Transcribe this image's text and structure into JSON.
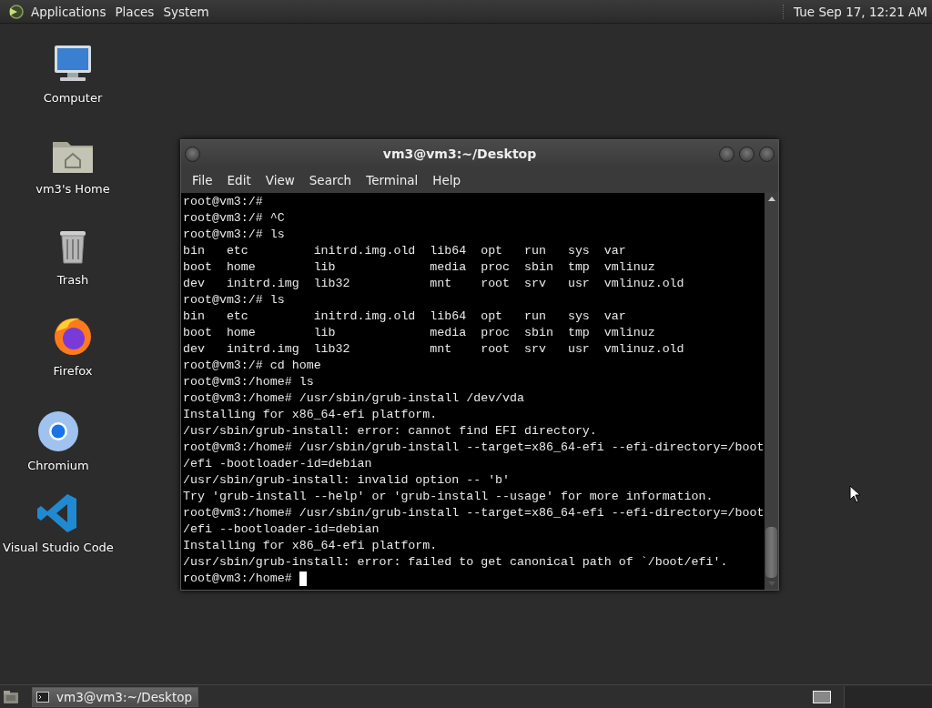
{
  "top_panel": {
    "menus": [
      "Applications",
      "Places",
      "System"
    ],
    "clock": "Tue Sep 17, 12:21 AM"
  },
  "desktop_icons": [
    {
      "kind": "computer",
      "label": "Computer"
    },
    {
      "kind": "home",
      "label": "vm3's Home"
    },
    {
      "kind": "trash",
      "label": "Trash"
    },
    {
      "kind": "firefox",
      "label": "Firefox"
    },
    {
      "kind": "chromium",
      "label": "Chromium"
    },
    {
      "kind": "vscode",
      "label": "Visual Studio Code"
    }
  ],
  "terminal_window": {
    "title": "vm3@vm3:~/Desktop",
    "menu": [
      "File",
      "Edit",
      "View",
      "Search",
      "Terminal",
      "Help"
    ],
    "lines": [
      "root@vm3:/#",
      "root@vm3:/# ^C",
      "root@vm3:/# ls",
      "bin   etc         initrd.img.old  lib64  opt   run   sys  var",
      "boot  home        lib             media  proc  sbin  tmp  vmlinuz",
      "dev   initrd.img  lib32           mnt    root  srv   usr  vmlinuz.old",
      "root@vm3:/# ls",
      "bin   etc         initrd.img.old  lib64  opt   run   sys  var",
      "boot  home        lib             media  proc  sbin  tmp  vmlinuz",
      "dev   initrd.img  lib32           mnt    root  srv   usr  vmlinuz.old",
      "root@vm3:/# cd home",
      "root@vm3:/home# ls",
      "root@vm3:/home# /usr/sbin/grub-install /dev/vda",
      "Installing for x86_64-efi platform.",
      "/usr/sbin/grub-install: error: cannot find EFI directory.",
      "root@vm3:/home# /usr/sbin/grub-install --target=x86_64-efi --efi-directory=/boot",
      "/efi -bootloader-id=debian",
      "/usr/sbin/grub-install: invalid option -- 'b'",
      "Try 'grub-install --help' or 'grub-install --usage' for more information.",
      "root@vm3:/home# /usr/sbin/grub-install --target=x86_64-efi --efi-directory=/boot",
      "/efi --bootloader-id=debian",
      "Installing for x86_64-efi platform.",
      "/usr/sbin/grub-install: error: failed to get canonical path of `/boot/efi'.",
      "root@vm3:/home# "
    ],
    "cursor_visible": true
  },
  "taskbar": {
    "tasks": [
      {
        "label": "vm3@vm3:~/Desktop",
        "selected": true
      }
    ]
  }
}
